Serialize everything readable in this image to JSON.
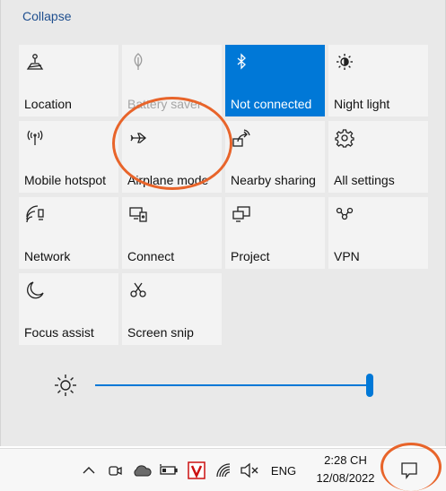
{
  "panel": {
    "collapse_label": "Collapse"
  },
  "tiles": [
    {
      "label": "Location",
      "icon": "location-icon",
      "state": "off"
    },
    {
      "label": "Battery saver",
      "icon": "battery-saver-icon",
      "state": "disabled"
    },
    {
      "label": "Not connected",
      "icon": "bluetooth-icon",
      "state": "active"
    },
    {
      "label": "Night light",
      "icon": "night-light-icon",
      "state": "off"
    },
    {
      "label": "Mobile hotspot",
      "icon": "mobile-hotspot-icon",
      "state": "off"
    },
    {
      "label": "Airplane mode",
      "icon": "airplane-icon",
      "state": "off"
    },
    {
      "label": "Nearby sharing",
      "icon": "nearby-sharing-icon",
      "state": "off"
    },
    {
      "label": "All settings",
      "icon": "gear-icon",
      "state": "off"
    },
    {
      "label": "Network",
      "icon": "network-icon",
      "state": "off"
    },
    {
      "label": "Connect",
      "icon": "connect-icon",
      "state": "off"
    },
    {
      "label": "Project",
      "icon": "project-icon",
      "state": "off"
    },
    {
      "label": "VPN",
      "icon": "vpn-icon",
      "state": "off"
    },
    {
      "label": "Focus assist",
      "icon": "moon-icon",
      "state": "off"
    },
    {
      "label": "Screen snip",
      "icon": "scissors-icon",
      "state": "off"
    }
  ],
  "brightness": {
    "icon": "brightness-sun-icon",
    "level": 1.0
  },
  "taskbar": {
    "language": "ENG",
    "time": "2:28 CH",
    "date": "12/08/2022",
    "tray_icons": [
      "chevron-up-icon",
      "meet-now-icon",
      "onedrive-cloud-icon",
      "battery-icon",
      "antivirus-v-icon",
      "wifi-icon",
      "volume-muted-icon"
    ],
    "notification_icon": "action-center-icon"
  },
  "colors": {
    "accent": "#0078d7",
    "panel_bg": "#e9e9e9",
    "tile_bg": "#f3f3f3",
    "annotation": "#e8642a",
    "link": "#1f4f8f"
  }
}
